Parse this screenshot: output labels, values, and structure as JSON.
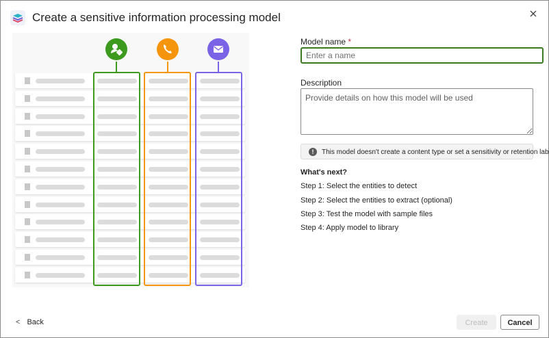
{
  "dialog": {
    "title": "Create a sensitive information processing model",
    "close_icon": "close-icon"
  },
  "illustration": {
    "icons": [
      "person-tag-icon",
      "phone-icon",
      "mail-icon"
    ],
    "colors": {
      "green": "#3c9a1f",
      "orange": "#f4950d",
      "purple": "#7a63e4"
    }
  },
  "form": {
    "model_name_label": "Model name",
    "required_mark": "*",
    "model_name_value": "",
    "model_name_placeholder": "Enter a name",
    "description_label": "Description",
    "description_placeholder": "Provide details on how this model will be used",
    "info_text": "This model doesn't create a content type or set a sensitivity or retention label",
    "info_icon_glyph": "!"
  },
  "next": {
    "title": "What's next?",
    "steps": [
      "Step 1: Select the entities to detect",
      "Step 2: Select the entities to extract (optional)",
      "Step 3: Test the model with sample files",
      "Step 4: Apply model to library"
    ]
  },
  "footer": {
    "back_glyph": "<",
    "back_label": "Back",
    "create_label": "Create",
    "cancel_label": "Cancel"
  }
}
